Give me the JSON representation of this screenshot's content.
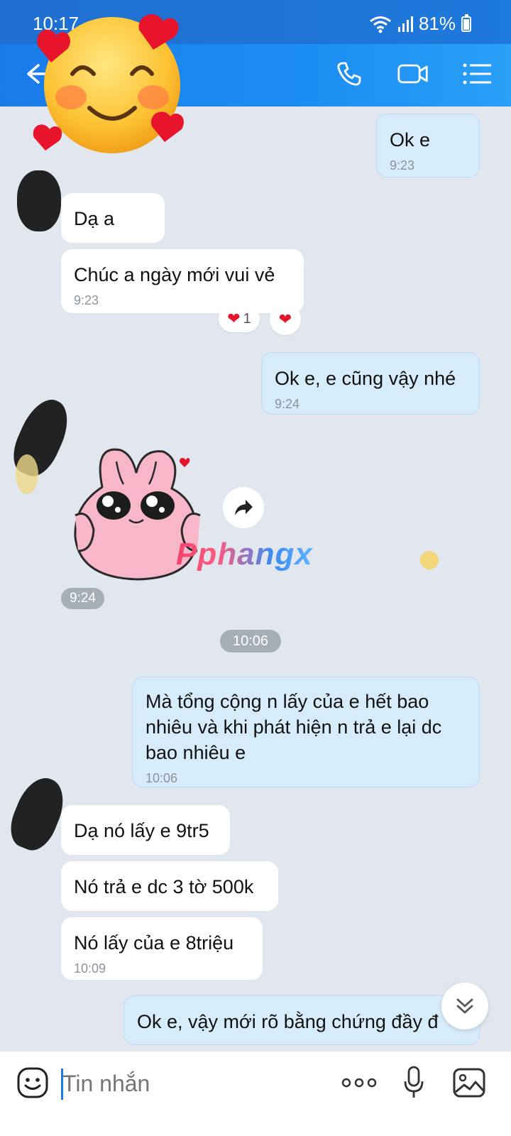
{
  "status_bar": {
    "time": "10:17",
    "battery": "81%"
  },
  "header": {
    "back_icon": "arrow-left-icon",
    "icons": [
      "phone-icon",
      "video-camera-icon",
      "menu-list-icon"
    ]
  },
  "messages": [
    {
      "id": "m1",
      "side": "me",
      "text": "Ok e",
      "time": "9:23"
    },
    {
      "id": "m2",
      "side": "them",
      "text": "Dạ a"
    },
    {
      "id": "m3",
      "side": "them",
      "text": "Chúc a ngày mới vui vẻ",
      "time": "9:23"
    },
    {
      "id": "m4",
      "side": "me",
      "text": "Ok e, e cũng vậy nhé",
      "time": "9:24"
    },
    {
      "id": "m6",
      "side": "me",
      "text": "Mà tổng cộng n lấy của e hết bao nhiêu và khi phát hiện n trả e lại dc bao nhiêu e",
      "time": "10:06"
    },
    {
      "id": "m7",
      "side": "them",
      "text": "Dạ nó lấy e 9tr5"
    },
    {
      "id": "m8",
      "side": "them",
      "text": "Nó trả e dc 3 tờ 500k"
    },
    {
      "id": "m9",
      "side": "them",
      "text": "Nó lấy của e 8triệu",
      "time": "10:09"
    },
    {
      "id": "m10",
      "side": "me",
      "text": "Ok e, vậy mới rõ bằng chứng đầy đ"
    }
  ],
  "reactions": {
    "heart_count": "1"
  },
  "sticker": {
    "time": "9:24",
    "watermark": "Pphangx"
  },
  "date_divider": "10:06",
  "input": {
    "placeholder": "Tin nhắn"
  },
  "colors": {
    "accent": "#1a7be8",
    "my_bubble": "#d7ecfb",
    "their_bubble": "#ffffff",
    "background": "#e2e7ef"
  }
}
